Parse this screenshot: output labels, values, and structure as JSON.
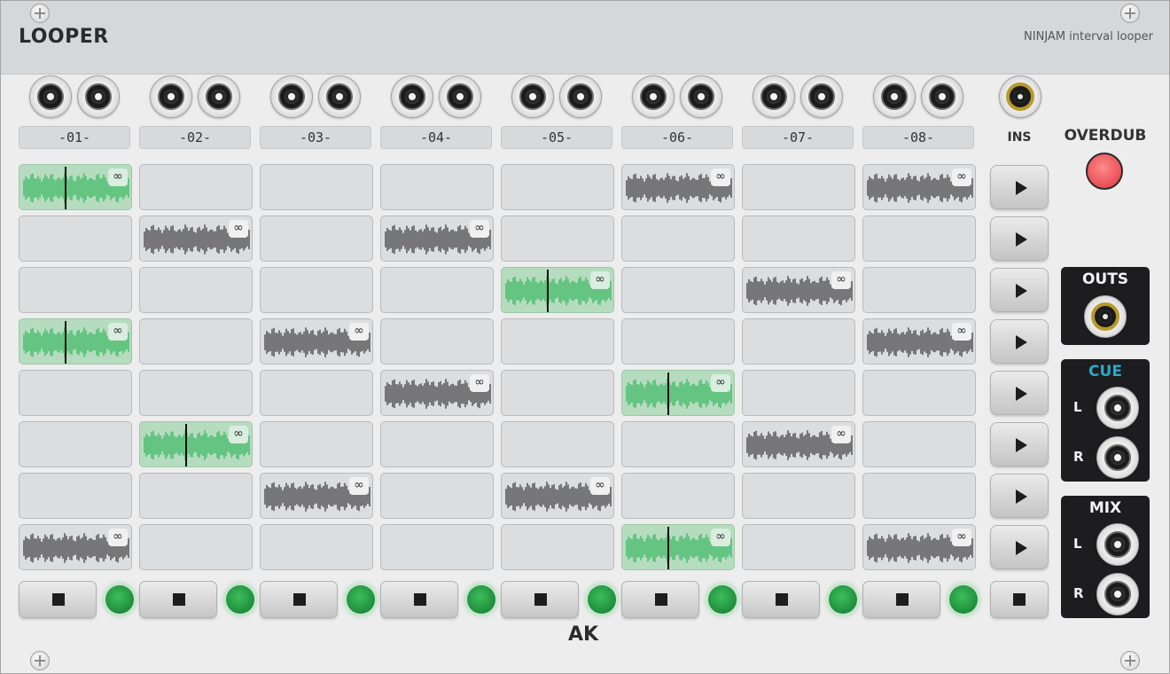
{
  "module": {
    "title": "LOOPER",
    "subtitle": "NINJAM interval looper",
    "brand": "AK"
  },
  "channels": [
    {
      "label": "-01-"
    },
    {
      "label": "-02-"
    },
    {
      "label": "-03-"
    },
    {
      "label": "-04-"
    },
    {
      "label": "-05-"
    },
    {
      "label": "-06-"
    },
    {
      "label": "-07-"
    },
    {
      "label": "-08-"
    }
  ],
  "ins_label": "INS",
  "overdub_label": "OVERDUB",
  "outs": {
    "label": "OUTS"
  },
  "cue": {
    "label": "CUE",
    "left": "L",
    "right": "R"
  },
  "mix": {
    "label": "MIX",
    "left": "L",
    "right": "R"
  },
  "loop_symbol": "∞",
  "grid": [
    [
      "playing",
      "empty",
      "empty",
      "empty",
      "empty",
      "loaded",
      "empty",
      "loaded"
    ],
    [
      "empty",
      "loaded",
      "empty",
      "loaded",
      "empty",
      "empty",
      "empty",
      "empty"
    ],
    [
      "empty",
      "empty",
      "empty",
      "empty",
      "playing",
      "empty",
      "loaded",
      "empty"
    ],
    [
      "playing",
      "empty",
      "loaded",
      "empty",
      "empty",
      "empty",
      "empty",
      "loaded"
    ],
    [
      "empty",
      "empty",
      "empty",
      "loaded",
      "empty",
      "playing",
      "empty",
      "empty"
    ],
    [
      "empty",
      "playing",
      "empty",
      "empty",
      "empty",
      "empty",
      "loaded",
      "empty"
    ],
    [
      "empty",
      "empty",
      "loaded",
      "empty",
      "loaded",
      "empty",
      "empty",
      "empty"
    ],
    [
      "loaded",
      "empty",
      "empty",
      "empty",
      "empty",
      "playing",
      "empty",
      "loaded"
    ]
  ],
  "colors": {
    "playing_wave": "#2fb45a",
    "loaded_wave": "#333333",
    "cue_label": "#29a9c9",
    "led_green": "#2aa84a",
    "overdub_red": "#ee5a60"
  },
  "icons": {
    "scene_launch": "play-triangle",
    "stop": "stop-square"
  }
}
